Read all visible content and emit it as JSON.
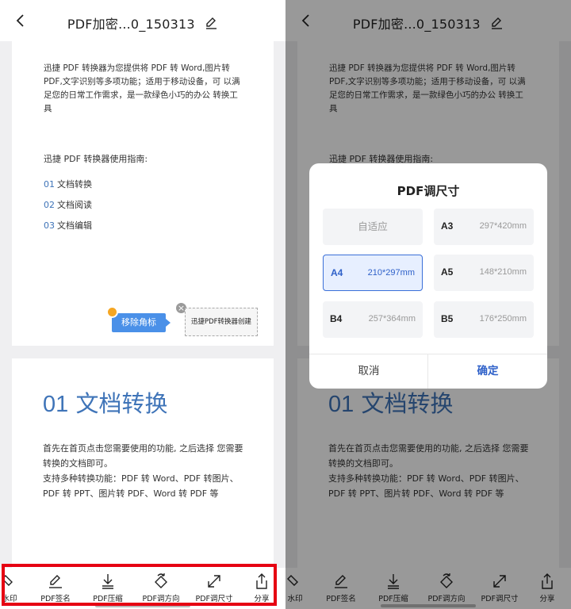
{
  "header": {
    "title": "PDF加密...0_150313"
  },
  "doc": {
    "intro": "迅捷 PDF 转换器为您提供将 PDF 转 Word,图片转 PDF,文字识别等多项功能；适用于移动设备，可 以满足您的日常工作需求，是一款绿色小巧的办公 转换工具",
    "guide_title": "迅捷 PDF 转换器使用指南:",
    "guide_items": [
      {
        "num": "01",
        "text": "文档转换"
      },
      {
        "num": "02",
        "text": "文档阅读"
      },
      {
        "num": "03",
        "text": "文档编辑"
      }
    ],
    "watermark": {
      "remove_label": "移除角标",
      "box_text": "迅捷PDF转换器创建",
      "close": "×"
    },
    "section_heading_num": "01",
    "section_heading_text": "文档转换",
    "section_body_1": "首先在首页点击您需要使用的功能, 之后选择 您需要转换的文档即可。",
    "section_body_2": "支持多种转换功能：PDF 转 Word、PDF 转图片、PDF 转 PPT、图片转 PDF、Word 转 PDF 等"
  },
  "toolbar": {
    "items": [
      {
        "label": "水印",
        "icon": "watermark-icon"
      },
      {
        "label": "PDF签名",
        "icon": "signature-icon"
      },
      {
        "label": "PDF压缩",
        "icon": "compress-icon"
      },
      {
        "label": "PDF调方向",
        "icon": "rotate-icon"
      },
      {
        "label": "PDF调尺寸",
        "icon": "resize-icon"
      },
      {
        "label": "分享",
        "icon": "share-icon"
      }
    ]
  },
  "dialog": {
    "title": "PDF调尺寸",
    "options": [
      {
        "name": "自适应",
        "dim": ""
      },
      {
        "name": "A3",
        "dim": "297*420mm"
      },
      {
        "name": "A4",
        "dim": "210*297mm",
        "selected": true
      },
      {
        "name": "A5",
        "dim": "148*210mm"
      },
      {
        "name": "B4",
        "dim": "257*364mm"
      },
      {
        "name": "B5",
        "dim": "176*250mm"
      }
    ],
    "cancel": "取消",
    "confirm": "确定"
  },
  "colors": {
    "accent": "#2f61c9",
    "heading": "#3f74b8",
    "highlight": "#e60012",
    "badge": "#4a90e8"
  }
}
